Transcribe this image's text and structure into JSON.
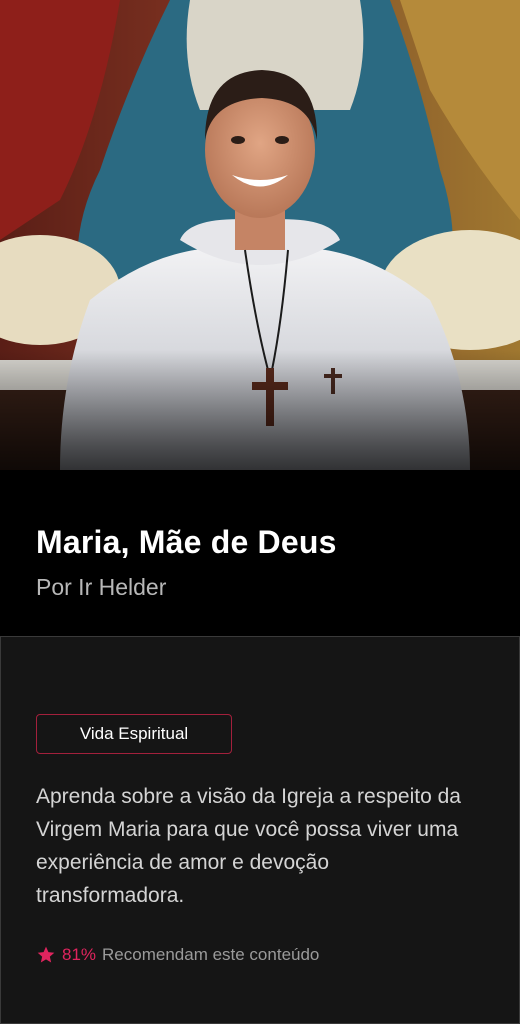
{
  "hero": {
    "title": "Maria, Mãe de Deus",
    "author": "Por Ir Helder",
    "image": "portrait-of-smiling-religious-brother-in-white-habit-before-painting-of-virgin-mary"
  },
  "content": {
    "category": "Vida Espiritual",
    "description": "Aprenda sobre a visão da Igreja a respeito da Virgem Maria para que você possa viver uma experiência de amor e devoção transformadora.",
    "rating": {
      "icon": "star-icon",
      "percent": "81%",
      "label": "Recomendam este conteúdo"
    }
  },
  "colors": {
    "accent": "#e0245e",
    "badge_border": "#a3203c",
    "panel_bg": "#151515",
    "hero_bg": "#000000"
  }
}
